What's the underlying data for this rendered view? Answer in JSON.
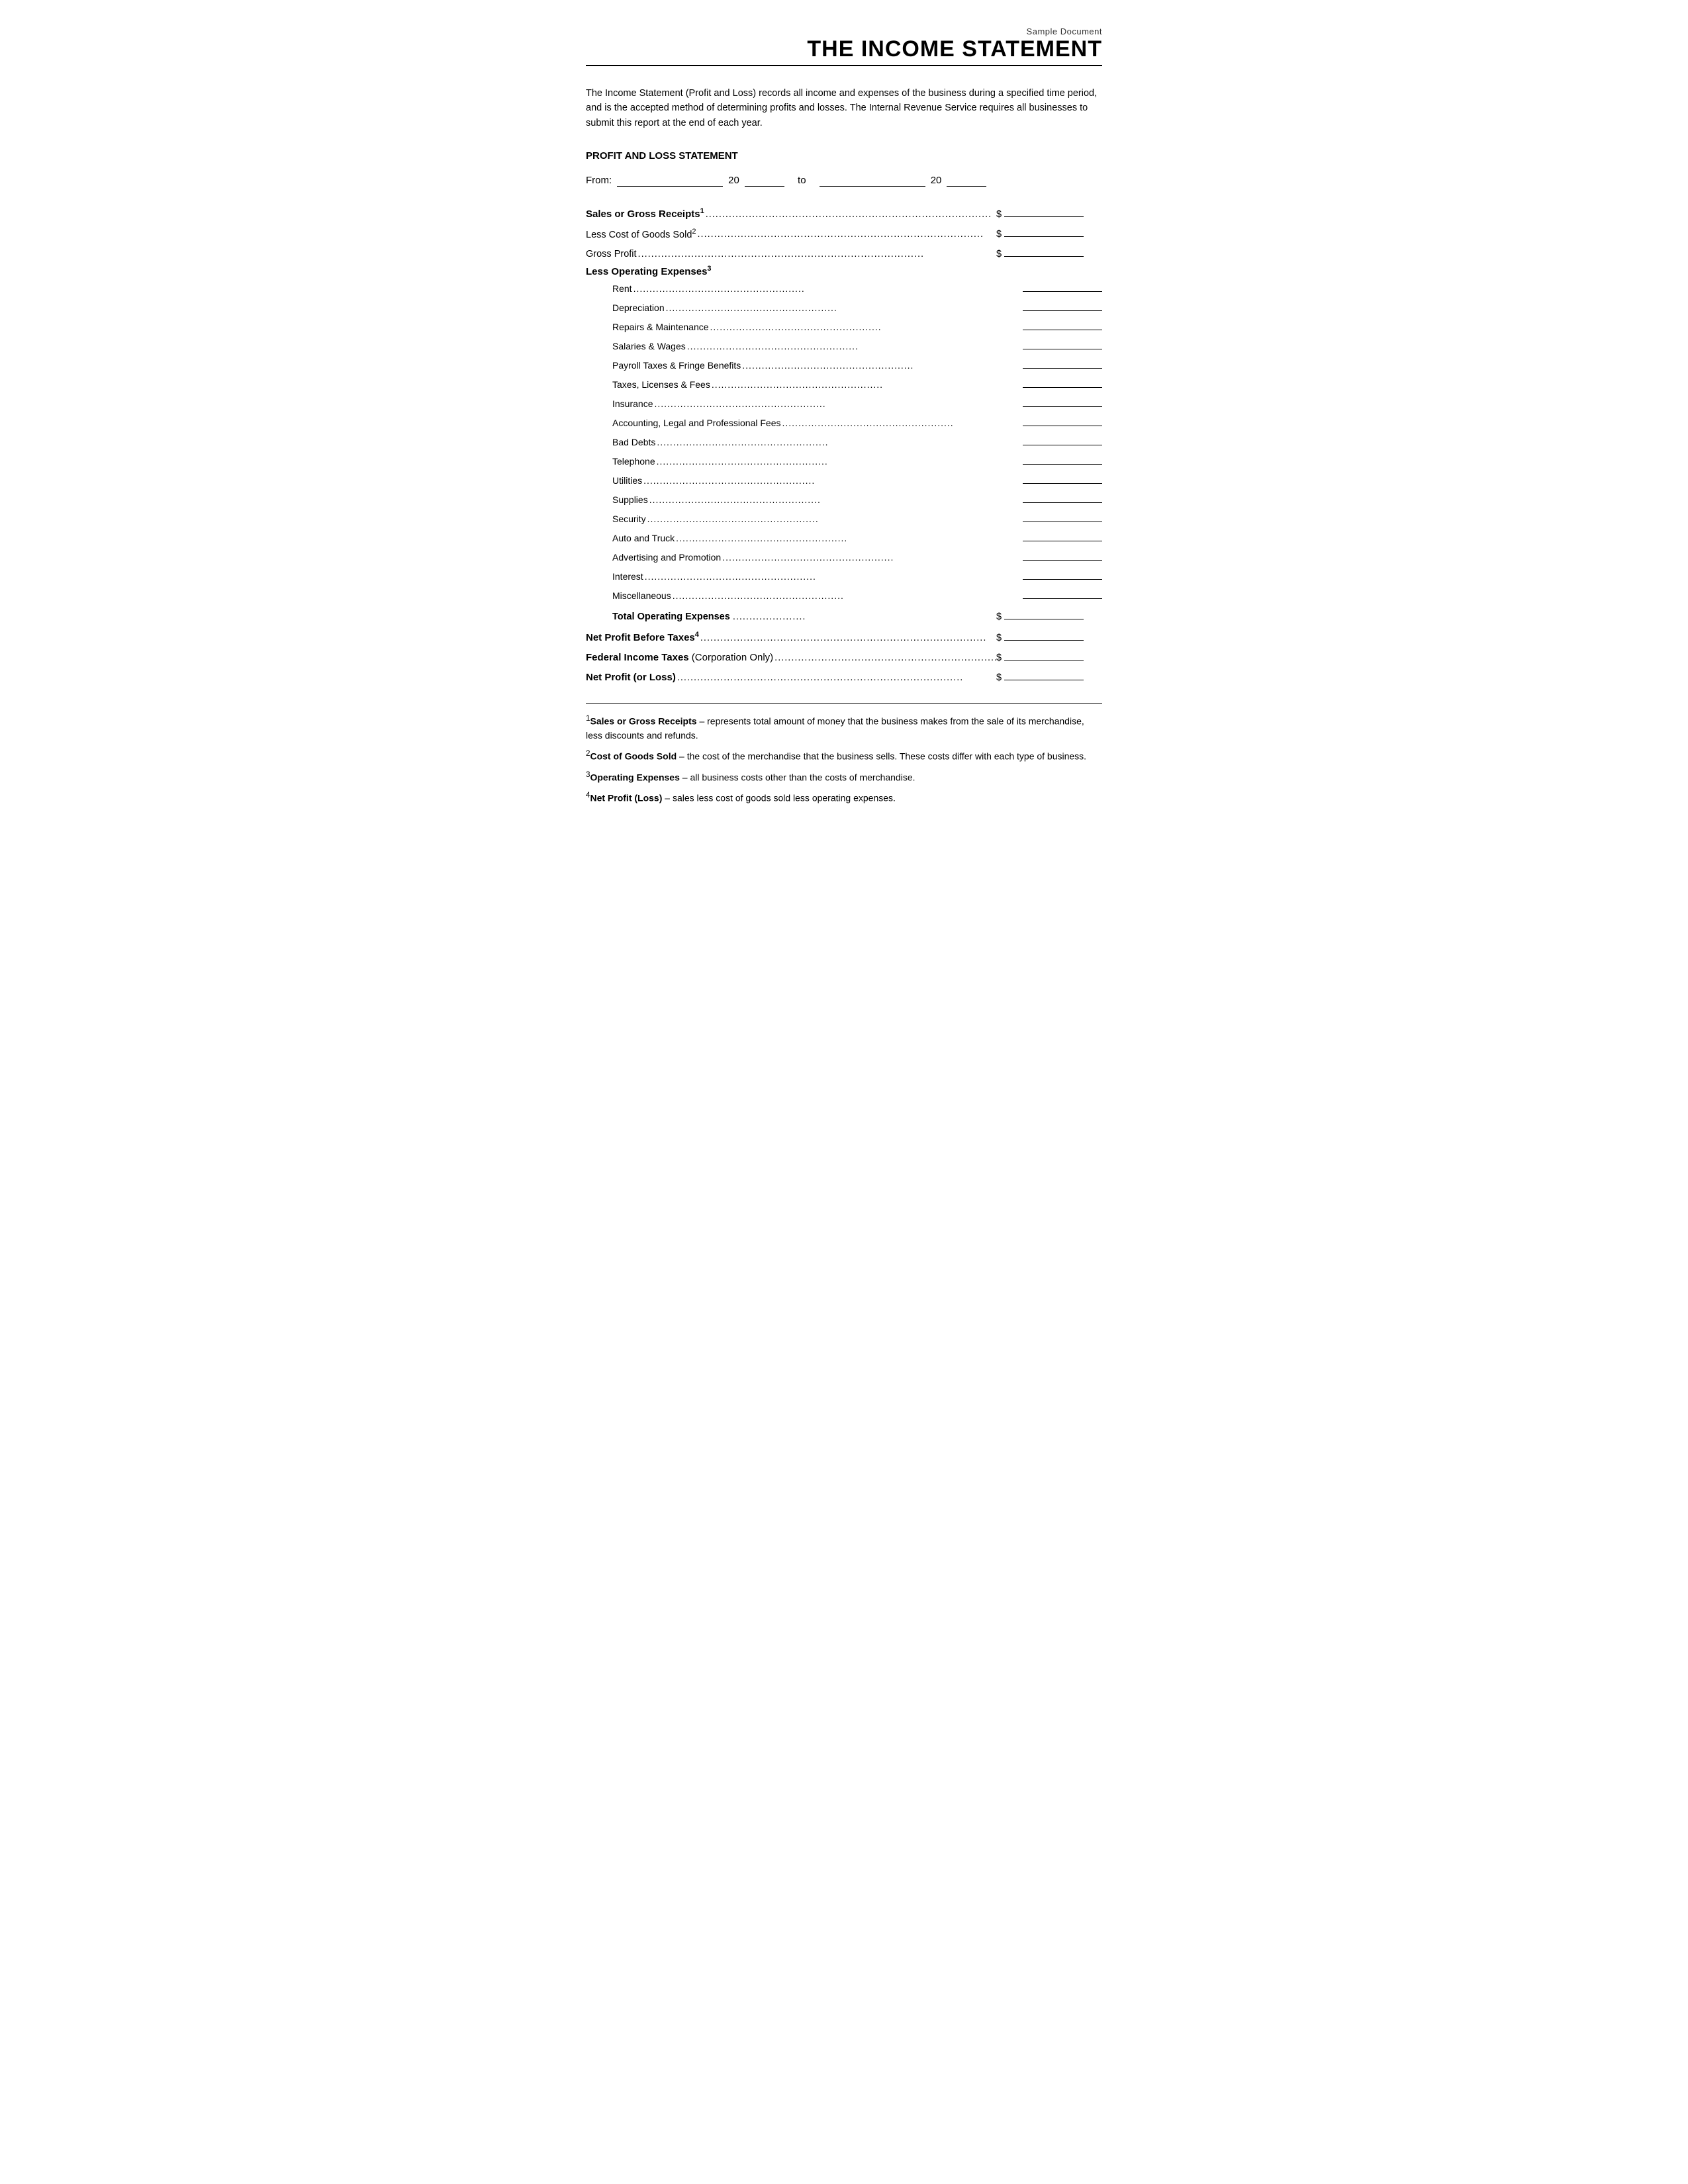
{
  "header": {
    "sample_label": "Sample Document",
    "title": "THE INCOME STATEMENT"
  },
  "intro": {
    "text": "The Income Statement (Profit and Loss) records all income and expenses of the business during a specified time period, and is the accepted method of determining profits and losses. The Internal Revenue Service requires all businesses to submit this report at the end of each year."
  },
  "section_title": "PROFIT AND LOSS STATEMENT",
  "from_line": {
    "from_label": "From:",
    "year1_label": "20",
    "to_label": "to",
    "year2_label": "20"
  },
  "rows": {
    "sales_label": "Sales or Gross Receipts",
    "sales_sup": "1",
    "less_cost_label": "Less Cost of Goods Sold",
    "less_cost_sup": "2",
    "gross_profit_label": "Gross Profit",
    "less_operating_label": "Less Operating Expenses",
    "less_operating_sup": "3"
  },
  "expense_items": [
    "Rent",
    "Depreciation",
    "Repairs & Maintenance",
    "Salaries & Wages",
    "Payroll Taxes & Fringe Benefits",
    "Taxes, Licenses & Fees",
    "Insurance",
    "Accounting, Legal and Professional Fees",
    "Bad Debts",
    "Telephone",
    "Utilities",
    "Supplies",
    "Security",
    "Auto and Truck",
    "Advertising and Promotion",
    "Interest",
    "Miscellaneous"
  ],
  "total_operating": {
    "label": "Total Operating Expenses"
  },
  "bottom_rows": [
    {
      "label": "Net Profit Before Taxes",
      "sup": "4",
      "bold": true
    },
    {
      "label": "Federal Income Taxes",
      "suffix": " (Corporation Only)",
      "bold": true
    },
    {
      "label": "Net Profit (or Loss)",
      "bold": true
    }
  ],
  "footnotes": [
    {
      "num": "1",
      "bold_part": "Sales or Gross Receipts",
      "text": " – represents total amount of money that the business makes from the sale of its merchandise, less discounts and refunds."
    },
    {
      "num": "2",
      "bold_part": "Cost of Goods Sold",
      "text": " – the cost of the merchandise that the business sells. These costs differ with each type of business."
    },
    {
      "num": "3",
      "bold_part": "Operating Expenses",
      "text": " – all business costs other than the costs of merchandise."
    },
    {
      "num": "4",
      "bold_part": "Net Profit (Loss)",
      "text": " – sales less cost of goods sold less operating expenses."
    }
  ]
}
